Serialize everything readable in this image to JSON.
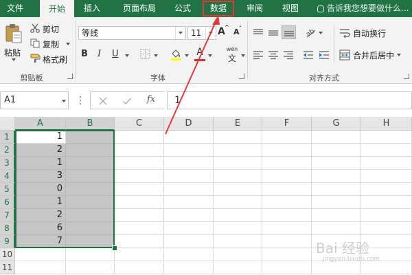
{
  "ribbon_tabs": {
    "file": "文件",
    "home": "开始",
    "insert": "插入",
    "page_layout": "页面布局",
    "formulas": "公式",
    "data": "数据",
    "review": "审阅",
    "view": "视图"
  },
  "tell_me": "告诉我您想要做什么...",
  "clipboard": {
    "paste": "粘贴",
    "cut": "剪切",
    "copy": "复制",
    "format_painter": "格式刷",
    "label": "剪贴板"
  },
  "font": {
    "name": "等线",
    "size": "11",
    "grow_label": "A",
    "shrink_label": "A",
    "bold_label": "B",
    "italic_label": "I",
    "underline_label": "U",
    "font_color_label": "A",
    "wen_label": "wén",
    "wen_char": "文",
    "label": "字体"
  },
  "alignment": {
    "wrap_text": "自动换行",
    "merge_center": "合并后居中",
    "label": "对齐方式"
  },
  "formula_bar": {
    "name_box": "A1",
    "fx_label": "fx",
    "formula_value": "1"
  },
  "sheet": {
    "columns": [
      "A",
      "B",
      "C",
      "D",
      "E",
      "F",
      "G",
      "H"
    ],
    "rows": [
      "1",
      "2",
      "3",
      "4",
      "5",
      "6",
      "7",
      "8",
      "9",
      "10",
      "11"
    ],
    "column_a_values": [
      "1",
      "2",
      "1",
      "3",
      "0",
      "1",
      "2",
      "6",
      "7"
    ]
  },
  "watermark": {
    "text": "Bai 经验",
    "sub": "jingyan.baidu.com"
  },
  "colors": {
    "excel_green": "#217346",
    "annotation_red": "#e53935",
    "selection_shade": "#c6c6c6"
  }
}
